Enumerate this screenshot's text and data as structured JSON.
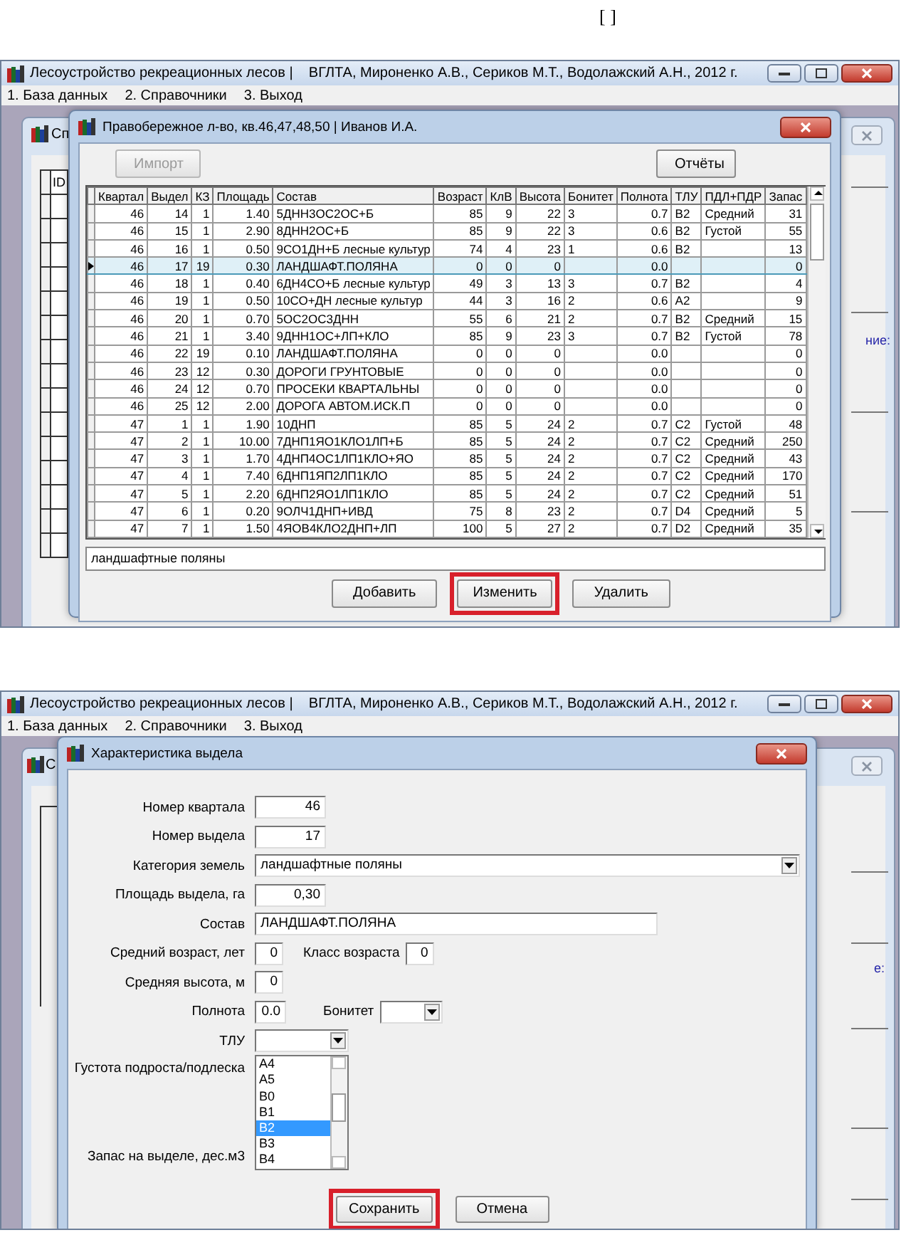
{
  "page_mark": "[ ]",
  "grid_screen": {
    "window": {
      "title": "Лесоустройство рекреационных лесов |    ВГЛТА, Мироненко А.В., Сериков М.Т., Водолажский А.Н., 2012 г."
    },
    "menu": [
      "1. База данных",
      "2. Справочники",
      "3. Выход"
    ],
    "background_window": {
      "title": "Сп",
      "column": "ID",
      "side_text": "ние:"
    },
    "dialog": {
      "title": "Правобережное л-во, кв.46,47,48,50 | Иванов И.А.",
      "top_buttons": [
        {
          "label": "Импорт",
          "disabled": true
        },
        {
          "label": "Отчёты",
          "disabled": false
        }
      ],
      "table": {
        "columns": [
          {
            "label": "Квартал",
            "kind": "number"
          },
          {
            "label": "Выдел",
            "kind": "number"
          },
          {
            "label": "КЗ",
            "kind": "number"
          },
          {
            "label": "Площадь",
            "kind": "number"
          },
          {
            "label": "Состав",
            "kind": "text"
          },
          {
            "label": "Возраст",
            "kind": "number"
          },
          {
            "label": "КлВ",
            "kind": "number"
          },
          {
            "label": "Высота",
            "kind": "number"
          },
          {
            "label": "Бонитет",
            "kind": "text"
          },
          {
            "label": "Полнота",
            "kind": "number"
          },
          {
            "label": "ТЛУ",
            "kind": "text"
          },
          {
            "label": "ПДЛ+ПДР",
            "kind": "text"
          },
          {
            "label": "Запас",
            "kind": "number"
          }
        ],
        "rows": [
          {
            "cells": [
              "46",
              "14",
              "1",
              "1.40",
              "5ДНН3ОС2ОС+Б",
              "85",
              "9",
              "22",
              "3",
              "0.7",
              "B2",
              "Средний",
              "31"
            ],
            "selected": false
          },
          {
            "cells": [
              "46",
              "15",
              "1",
              "2.90",
              "8ДНН2ОС+Б",
              "85",
              "9",
              "22",
              "3",
              "0.6",
              "B2",
              "Густой",
              "55"
            ],
            "selected": false
          },
          {
            "cells": [
              "46",
              "16",
              "1",
              "0.50",
              "9СО1ДН+Б лесные культур",
              "74",
              "4",
              "23",
              "1",
              "0.6",
              "B2",
              null,
              "13"
            ],
            "selected": false
          },
          {
            "cells": [
              "46",
              "17",
              "19",
              "0.30",
              "ЛАНДШАФТ.ПОЛЯНА",
              "0",
              "0",
              "0",
              null,
              "0.0",
              null,
              null,
              "0"
            ],
            "selected": true
          },
          {
            "cells": [
              "46",
              "18",
              "1",
              "0.40",
              "6ДН4СО+Б лесные культур",
              "49",
              "3",
              "13",
              "3",
              "0.7",
              "B2",
              null,
              "4"
            ],
            "selected": false
          },
          {
            "cells": [
              "46",
              "19",
              "1",
              "0.50",
              "10СО+ДН лесные культур",
              "44",
              "3",
              "16",
              "2",
              "0.6",
              "A2",
              null,
              "9"
            ],
            "selected": false
          },
          {
            "cells": [
              "46",
              "20",
              "1",
              "0.70",
              "5ОС2ОС3ДНН",
              "55",
              "6",
              "21",
              "2",
              "0.7",
              "B2",
              "Средний",
              "15"
            ],
            "selected": false
          },
          {
            "cells": [
              "46",
              "21",
              "1",
              "3.40",
              "9ДНН1ОС+ЛП+КЛО",
              "85",
              "9",
              "23",
              "3",
              "0.7",
              "B2",
              "Густой",
              "78"
            ],
            "selected": false
          },
          {
            "cells": [
              "46",
              "22",
              "19",
              "0.10",
              "ЛАНДШАФТ.ПОЛЯНА",
              "0",
              "0",
              "0",
              null,
              "0.0",
              null,
              null,
              "0"
            ],
            "selected": false
          },
          {
            "cells": [
              "46",
              "23",
              "12",
              "0.30",
              "ДОРОГИ ГРУНТОВЫЕ",
              "0",
              "0",
              "0",
              null,
              "0.0",
              null,
              null,
              "0"
            ],
            "selected": false
          },
          {
            "cells": [
              "46",
              "24",
              "12",
              "0.70",
              "ПРОСЕКИ КВАРТАЛЬНЫ",
              "0",
              "0",
              "0",
              null,
              "0.0",
              null,
              null,
              "0"
            ],
            "selected": false
          },
          {
            "cells": [
              "46",
              "25",
              "12",
              "2.00",
              "ДОРОГА АВТОМ.ИСК.П",
              "0",
              "0",
              "0",
              null,
              "0.0",
              null,
              null,
              "0"
            ],
            "selected": false
          },
          {
            "cells": [
              "47",
              "1",
              "1",
              "1.90",
              "10ДНП",
              "85",
              "5",
              "24",
              "2",
              "0.7",
              "C2",
              "Густой",
              "48"
            ],
            "selected": false
          },
          {
            "cells": [
              "47",
              "2",
              "1",
              "10.00",
              "7ДНП1ЯО1КЛО1ЛП+Б",
              "85",
              "5",
              "24",
              "2",
              "0.7",
              "C2",
              "Средний",
              "250"
            ],
            "selected": false
          },
          {
            "cells": [
              "47",
              "3",
              "1",
              "1.70",
              "4ДНП4ОС1ЛП1КЛО+ЯО",
              "85",
              "5",
              "24",
              "2",
              "0.7",
              "C2",
              "Средний",
              "43"
            ],
            "selected": false
          },
          {
            "cells": [
              "47",
              "4",
              "1",
              "7.40",
              "6ДНП1ЯП2ЛП1КЛО",
              "85",
              "5",
              "24",
              "2",
              "0.7",
              "C2",
              "Средний",
              "170"
            ],
            "selected": false
          },
          {
            "cells": [
              "47",
              "5",
              "1",
              "2.20",
              "6ДНП2ЯО1ЛП1КЛО",
              "85",
              "5",
              "24",
              "2",
              "0.7",
              "C2",
              "Средний",
              "51"
            ],
            "selected": false
          },
          {
            "cells": [
              "47",
              "6",
              "1",
              "0.20",
              "9ОЛЧ1ДНП+ИВД",
              "75",
              "8",
              "23",
              "2",
              "0.7",
              "D4",
              "Средний",
              "5"
            ],
            "selected": false
          },
          {
            "cells": [
              "47",
              "7",
              "1",
              "1.50",
              "4ЯОВ4КЛО2ДНП+ЛП",
              "100",
              "5",
              "27",
              "2",
              "0.7",
              "D2",
              "Средний",
              "35"
            ],
            "selected": false
          }
        ]
      },
      "note": "ландшафтные поляны",
      "buttons": [
        {
          "label": "Добавить",
          "highlighted": false
        },
        {
          "label": "Изменить",
          "highlighted": true
        },
        {
          "label": "Удалить",
          "highlighted": false
        }
      ]
    }
  },
  "form_screen": {
    "window": {
      "title": "Лесоустройство рекреационных лесов |    ВГЛТА, Мироненко А.В., Сериков М.Т., Водолажский А.Н., 2012 г."
    },
    "menu": [
      "1. База данных",
      "2. Справочники",
      "3. Выход"
    ],
    "background_window": {
      "title": "С",
      "side_text": "е:"
    },
    "dialog": {
      "title": "Характеристика выдела",
      "fields": [
        {
          "kind": "number",
          "label": "Номер квартала",
          "value": "46"
        },
        {
          "kind": "number",
          "label": "Номер выдела",
          "value": "17"
        },
        {
          "kind": "combo",
          "label": "Категория земель",
          "value": "ландшафтные поляны"
        },
        {
          "kind": "number",
          "label": "Площадь выдела, га",
          "value": "0,30"
        },
        {
          "kind": "wide",
          "label": "Состав",
          "value": "ЛАНДШАФТ.ПОЛЯНА"
        },
        {
          "kind": "pair",
          "label": "Средний возраст, лет",
          "value": "0",
          "label2": "Класс возраста",
          "value2": "0"
        },
        {
          "kind": "small",
          "label": "Средняя высота, м",
          "value": "0"
        },
        {
          "kind": "pair_combo",
          "label": "Полнота",
          "value": "0.0",
          "label2": "Бонитет"
        },
        {
          "kind": "dropdown",
          "label": "ТЛУ",
          "options": [
            {
              "label": "A4",
              "selected": false
            },
            {
              "label": "A5",
              "selected": false
            },
            {
              "label": "B0",
              "selected": false
            },
            {
              "label": "B1",
              "selected": false
            },
            {
              "label": "B2",
              "selected": true
            },
            {
              "label": "B3",
              "selected": false
            },
            {
              "label": "B4",
              "selected": false
            }
          ]
        },
        {
          "kind": "covered",
          "label": "Густота подроста/подлеска"
        },
        {
          "kind": "covered",
          "label": "Запас на выделе, дес.м3"
        }
      ],
      "buttons": [
        {
          "label": "Сохранить",
          "highlighted": true
        },
        {
          "label": "Отмена",
          "highlighted": false
        }
      ]
    }
  }
}
